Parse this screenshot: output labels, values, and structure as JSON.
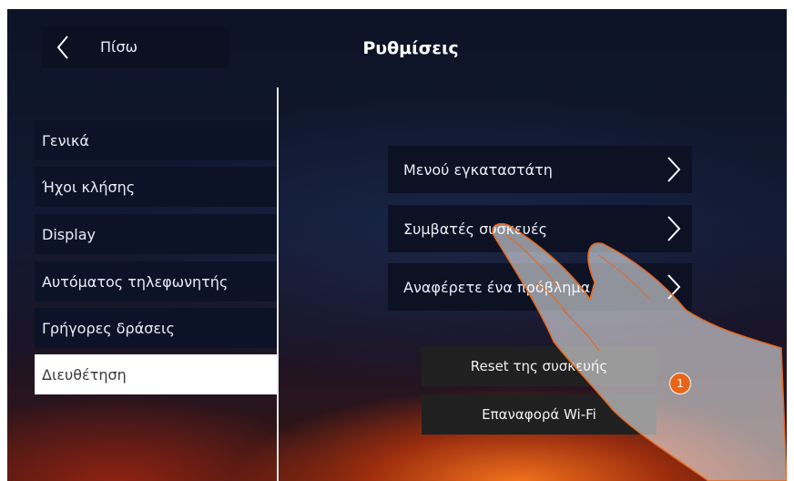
{
  "header": {
    "back_label": "Πίσω",
    "title": "Ρυθμίσεις"
  },
  "sidebar": {
    "items": [
      {
        "label": "Γενικά",
        "active": false
      },
      {
        "label": "Ήχοι κλήσης",
        "active": false
      },
      {
        "label": "Display",
        "active": false
      },
      {
        "label": "Αυτόματος τηλεφωνητής",
        "active": false
      },
      {
        "label": "Γρήγορες δράσεις",
        "active": false
      },
      {
        "label": "Διευθέτηση",
        "active": true
      }
    ]
  },
  "main": {
    "options": [
      {
        "label": "Μενού εγκαταστάτη"
      },
      {
        "label": "Συμβατές συσκευές"
      },
      {
        "label": "Αναφέρετε ένα πρόβλημα"
      }
    ],
    "actions": [
      {
        "label": "Reset της συσκευής"
      },
      {
        "label": "Επαναφορά Wi-Fi"
      }
    ]
  },
  "callout": {
    "number": "1"
  },
  "colors": {
    "accent": "#e8661a",
    "panel": "#0c1328",
    "active_item": "#ffffff"
  },
  "icons": {
    "back": "chevron-left-icon",
    "option": "chevron-right-icon",
    "gesture": "hand-tap-icon"
  }
}
